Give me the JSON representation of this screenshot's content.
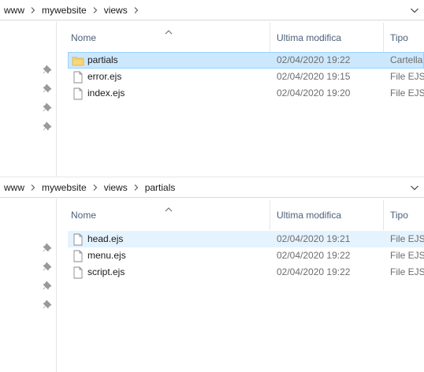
{
  "panes": [
    {
      "breadcrumb": [
        "www",
        "mywebsite",
        "views"
      ],
      "columns": {
        "name": "Nome",
        "date": "Ultima modifica",
        "type": "Tipo"
      },
      "rows": [
        {
          "name": "partials",
          "date": "02/04/2020 19:22",
          "type": "Cartella",
          "icon": "folder-icon"
        },
        {
          "name": "error.ejs",
          "date": "02/04/2020 19:15",
          "type": "File EJS",
          "icon": "file-icon"
        },
        {
          "name": "index.ejs",
          "date": "02/04/2020 19:20",
          "type": "File EJS",
          "icon": "file-icon"
        }
      ]
    },
    {
      "breadcrumb": [
        "www",
        "mywebsite",
        "views",
        "partials"
      ],
      "columns": {
        "name": "Nome",
        "date": "Ultima modifica",
        "type": "Tipo"
      },
      "rows": [
        {
          "name": "head.ejs",
          "date": "02/04/2020 19:21",
          "type": "File EJS",
          "icon": "file-icon"
        },
        {
          "name": "menu.ejs",
          "date": "02/04/2020 19:22",
          "type": "File EJS",
          "icon": "file-icon"
        },
        {
          "name": "script.ejs",
          "date": "02/04/2020 19:22",
          "type": "File EJS",
          "icon": "file-icon"
        }
      ]
    }
  ],
  "colors": {
    "selection": "#cce8ff",
    "hover": "#e5f3ff",
    "header_text": "#4c607a",
    "folder": "#f8d775"
  }
}
